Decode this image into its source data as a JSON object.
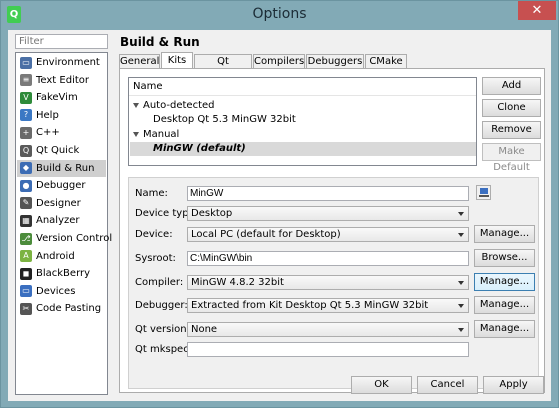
{
  "window": {
    "title": "Options",
    "icon": "qt-creator-icon",
    "close_glyph": "✕"
  },
  "sidebar": {
    "filter_placeholder": "Filter",
    "items": [
      {
        "label": "Environment",
        "icon": "monitor-icon",
        "color": "#4a6fa5"
      },
      {
        "label": "Text Editor",
        "icon": "text-editor-icon",
        "color": "#7a7a7a"
      },
      {
        "label": "FakeVim",
        "icon": "fakevim-icon",
        "color": "#2e8b3a"
      },
      {
        "label": "Help",
        "icon": "help-icon",
        "color": "#3b78c4"
      },
      {
        "label": "C++",
        "icon": "cpp-icon",
        "color": "#6a6a6a"
      },
      {
        "label": "Qt Quick",
        "icon": "qt-quick-icon",
        "color": "#5a5a5a"
      },
      {
        "label": "Build & Run",
        "icon": "build-run-icon",
        "color": "#3c6cb4"
      },
      {
        "label": "Debugger",
        "icon": "debugger-icon",
        "color": "#3c6cb4"
      },
      {
        "label": "Designer",
        "icon": "designer-icon",
        "color": "#555555"
      },
      {
        "label": "Analyzer",
        "icon": "analyzer-icon",
        "color": "#333333"
      },
      {
        "label": "Version Control",
        "icon": "version-control-icon",
        "color": "#4c8c3c"
      },
      {
        "label": "Android",
        "icon": "android-icon",
        "color": "#7cb342"
      },
      {
        "label": "BlackBerry",
        "icon": "blackberry-icon",
        "color": "#222222"
      },
      {
        "label": "Devices",
        "icon": "devices-icon",
        "color": "#3b6fc0"
      },
      {
        "label": "Code Pasting",
        "icon": "code-pasting-icon",
        "color": "#555555"
      }
    ],
    "selected_index": 6
  },
  "main": {
    "title": "Build & Run",
    "tabs": [
      "General",
      "Kits",
      "Qt Versions",
      "Compilers",
      "Debuggers",
      "CMake"
    ],
    "active_tab": "Kits"
  },
  "kits": {
    "header": "Name",
    "groups": [
      {
        "label": "Auto-detected",
        "items": [
          "Desktop Qt 5.3 MinGW 32bit"
        ]
      },
      {
        "label": "Manual",
        "items": [
          "MinGW (default)"
        ]
      }
    ],
    "buttons": {
      "add": "Add",
      "clone": "Clone",
      "remove": "Remove",
      "make_default": "Make Default"
    }
  },
  "details": {
    "name": {
      "label": "Name:",
      "value": "MinGW"
    },
    "device_type": {
      "label": "Device type:",
      "value": "Desktop"
    },
    "device": {
      "label": "Device:",
      "value": "Local PC (default for Desktop)",
      "button": "Manage..."
    },
    "sysroot": {
      "label": "Sysroot:",
      "value": "C:\\MinGW\\bin",
      "button": "Browse..."
    },
    "compiler": {
      "label": "Compiler:",
      "value": "MinGW 4.8.2 32bit",
      "button": "Manage..."
    },
    "debugger": {
      "label": "Debugger:",
      "value": "Extracted from Kit Desktop Qt 5.3 MinGW 32bit",
      "button": "Manage..."
    },
    "qt_version": {
      "label": "Qt version:",
      "value": "None",
      "button": "Manage..."
    },
    "qt_mkspec": {
      "label": "Qt mkspec:",
      "value": ""
    }
  },
  "footer": {
    "ok": "OK",
    "cancel": "Cancel",
    "apply": "Apply"
  }
}
